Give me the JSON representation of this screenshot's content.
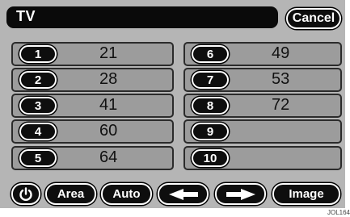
{
  "header": {
    "title": "TV",
    "cancel_label": "Cancel"
  },
  "presets": [
    {
      "number": "1",
      "channel": "21"
    },
    {
      "number": "2",
      "channel": "28"
    },
    {
      "number": "3",
      "channel": "41"
    },
    {
      "number": "4",
      "channel": "60"
    },
    {
      "number": "5",
      "channel": "64"
    },
    {
      "number": "6",
      "channel": "49"
    },
    {
      "number": "7",
      "channel": "53"
    },
    {
      "number": "8",
      "channel": "72"
    },
    {
      "number": "9",
      "channel": ""
    },
    {
      "number": "10",
      "channel": ""
    }
  ],
  "controls": {
    "power_icon": "power-icon",
    "area_label": "Area",
    "auto_label": "Auto",
    "seek_down_icon": "arrow-left-icon",
    "seek_up_icon": "arrow-right-icon",
    "image_label": "Image"
  },
  "figure_code": "JOL164"
}
